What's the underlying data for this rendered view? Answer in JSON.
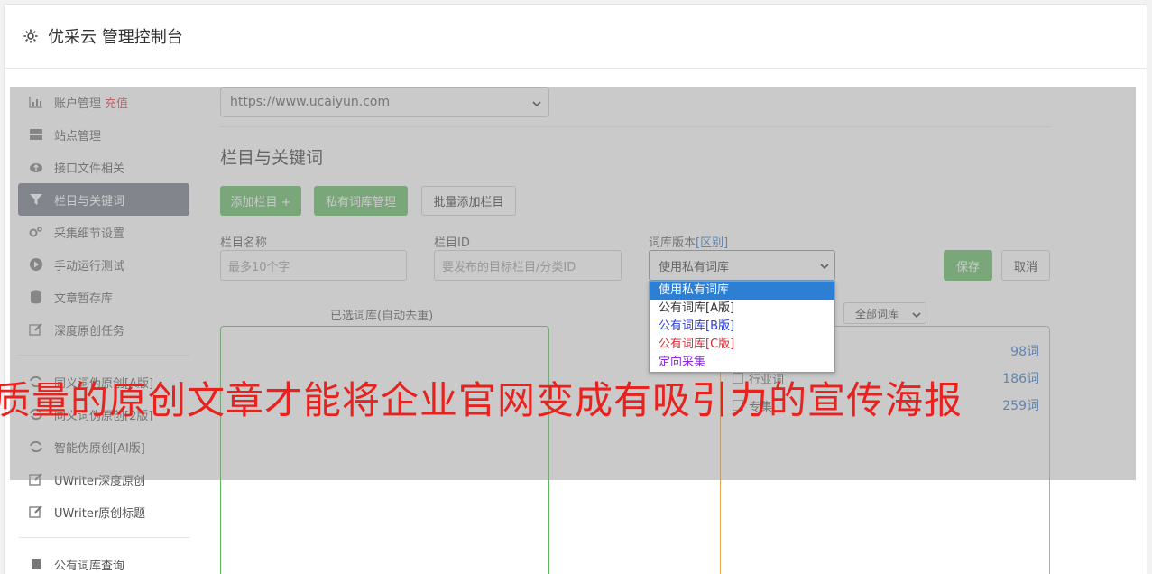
{
  "header": {
    "title": "优采云 管理控制台"
  },
  "sidebar": {
    "items": [
      {
        "label": "账户管理",
        "badge": "充值",
        "icon": "bar-chart-icon"
      },
      {
        "label": "站点管理",
        "icon": "server-icon"
      },
      {
        "label": "接口文件相关",
        "icon": "cloud-upload-icon"
      },
      {
        "label": "栏目与关键词",
        "icon": "filter-icon",
        "active": true
      },
      {
        "label": "采集细节设置",
        "icon": "cogs-icon"
      },
      {
        "label": "手动运行测试",
        "icon": "play-circle-icon"
      },
      {
        "label": "文章暂存库",
        "icon": "database-icon"
      },
      {
        "label": "深度原创任务",
        "icon": "edit-icon"
      }
    ],
    "items2": [
      {
        "label": "同义词伪原创[A版]",
        "icon": "refresh-icon"
      },
      {
        "label": "同义词伪原创[2版]",
        "icon": "refresh-icon"
      },
      {
        "label": "智能伪原创[AI版]",
        "icon": "refresh-icon"
      },
      {
        "label": "UWriter深度原创",
        "icon": "edit-icon"
      },
      {
        "label": "UWriter原创标题",
        "icon": "edit-icon"
      }
    ],
    "items3": [
      {
        "label": "公有词库查询",
        "icon": "book-icon"
      }
    ]
  },
  "main": {
    "site_select": "https://www.ucaiyun.com",
    "section_title": "栏目与关键词",
    "buttons": {
      "add_column": "添加栏目 +",
      "private_lib": "私有词库管理",
      "batch_add": "批量添加栏目",
      "save": "保存",
      "cancel": "取消"
    },
    "form": {
      "name_label": "栏目名称",
      "name_placeholder": "最多10个字",
      "id_label": "栏目ID",
      "id_placeholder": "要发布的目标栏目/分类ID",
      "lib_label": "词库版本",
      "lib_label_link": "[区别]",
      "lib_value": "使用私有词库"
    },
    "lib_options": [
      {
        "label": "使用私有词库",
        "color": "#ffffff",
        "selected": true
      },
      {
        "label": "公有词库[A版]",
        "color": "#333333"
      },
      {
        "label": "公有词库[B版]",
        "color": "#2a3fd6"
      },
      {
        "label": "公有词库[C版]",
        "color": "#d6303a"
      },
      {
        "label": "定向采集",
        "color": "#8a2be2"
      }
    ],
    "selected_panel_label": "已选词库(自动去重)",
    "filter_select": "全部词库",
    "lib_rows": [
      {
        "name": "",
        "count": "98词"
      },
      {
        "name": "行业词",
        "count": "186词"
      },
      {
        "name": "专集",
        "count": "259词"
      }
    ]
  },
  "overlay_text": "质量的原创文章才能将企业官网变成有吸引力的宣传海报",
  "colors": {
    "accent_green": "#5cb85c",
    "active_nav": "#6e7683",
    "link_blue": "#2a74c9",
    "banner_red": "#e8231f"
  }
}
